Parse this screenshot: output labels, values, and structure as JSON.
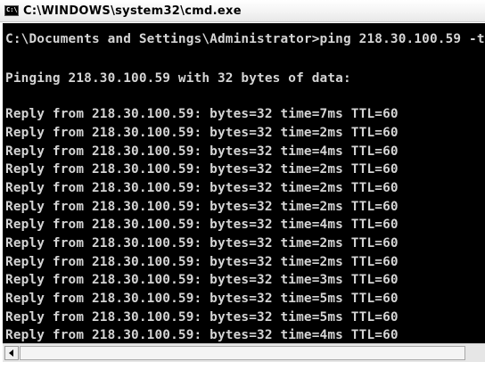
{
  "window": {
    "title": "C:\\WINDOWS\\system32\\cmd.exe",
    "icon_label": "C:\\"
  },
  "console": {
    "lines": [
      "C:\\Documents and Settings\\Administrator>ping 218.30.100.59 -t",
      "",
      "Pinging 218.30.100.59 with 32 bytes of data:",
      "",
      "Reply from 218.30.100.59: bytes=32 time=7ms TTL=60",
      "Reply from 218.30.100.59: bytes=32 time=2ms TTL=60",
      "Reply from 218.30.100.59: bytes=32 time=4ms TTL=60",
      "Reply from 218.30.100.59: bytes=32 time=2ms TTL=60",
      "Reply from 218.30.100.59: bytes=32 time=2ms TTL=60",
      "Reply from 218.30.100.59: bytes=32 time=2ms TTL=60",
      "Reply from 218.30.100.59: bytes=32 time=4ms TTL=60",
      "Reply from 218.30.100.59: bytes=32 time=2ms TTL=60",
      "Reply from 218.30.100.59: bytes=32 time=2ms TTL=60",
      "Reply from 218.30.100.59: bytes=32 time=3ms TTL=60",
      "Reply from 218.30.100.59: bytes=32 time=5ms TTL=60",
      "Reply from 218.30.100.59: bytes=32 time=5ms TTL=60",
      "Reply from 218.30.100.59: bytes=32 time=4ms TTL=60"
    ]
  },
  "scrollbar": {
    "left_arrow_icon": "arrow-left-icon"
  },
  "colors": {
    "console_background": "#000000",
    "console_text": "#d4d4d4"
  }
}
